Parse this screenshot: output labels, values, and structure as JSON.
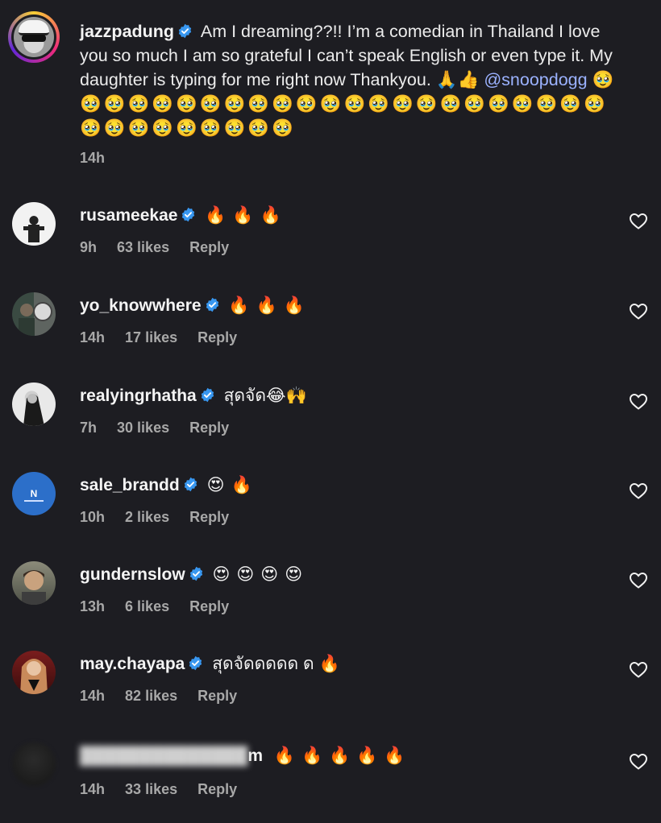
{
  "post": {
    "username": "jazzpadung",
    "text": "Am I dreaming??!! I’m a comedian in Thailand I love you so much I am so grateful I can’t speak English or even type it. My daughter is typing for me right now Thankyou.",
    "inline_emojis": "🙏👍",
    "mention": "@snoopdogg",
    "trailing_emojis": "🥹🥹🥹🥹🥹🥹🥹🥹🥹🥹🥹🥹🥹🥹🥹🥹🥹🥹🥹🥹🥹🥹🥹🥹🥹🥹🥹🥹🥹🥹🥹🥹",
    "time": "14h"
  },
  "comments": [
    {
      "username": "rusameekae",
      "text": "🔥🔥🔥",
      "time": "9h",
      "likes": "63 likes",
      "reply": "Reply"
    },
    {
      "username": "yo_knowwhere",
      "text": "🔥🔥🔥",
      "time": "14h",
      "likes": "17 likes",
      "reply": "Reply"
    },
    {
      "username": "realyingrhatha",
      "text": "สุดจัด😂🙌",
      "time": "7h",
      "likes": "30 likes",
      "reply": "Reply"
    },
    {
      "username": "sale_brandd",
      "text": "😍🔥",
      "time": "10h",
      "likes": "2 likes",
      "reply": "Reply"
    },
    {
      "username": "gundernslow",
      "text": "😍😍😍😍",
      "time": "13h",
      "likes": "6 likes",
      "reply": "Reply"
    },
    {
      "username": "may.chayapa",
      "text": "สุดจัดดดดด ด 🔥",
      "time": "14h",
      "likes": "82 likes",
      "reply": "Reply"
    },
    {
      "username": "m",
      "text": "🔥🔥🔥🔥🔥",
      "time": "14h",
      "likes": "33 likes",
      "reply": "Reply"
    }
  ],
  "colors": {
    "background": "#1d1d22",
    "verified": "#3897f0",
    "mention": "#9bb2ff",
    "meta": "#a8a8a8"
  },
  "icons": {
    "verified": "verified-badge-icon",
    "like": "heart-outline-icon"
  }
}
